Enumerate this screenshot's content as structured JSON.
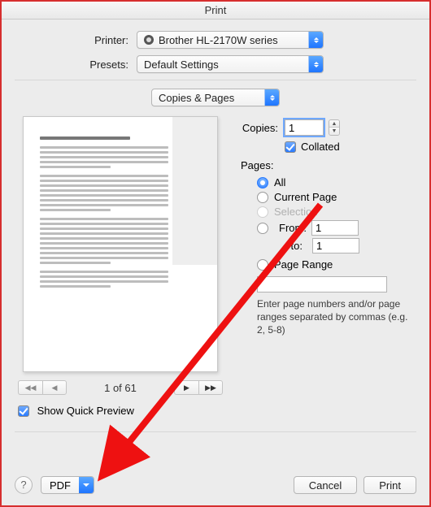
{
  "title": "Print",
  "labels": {
    "printer": "Printer:",
    "presets": "Presets:",
    "copies": "Copies:",
    "collated": "Collated",
    "pages": "Pages:",
    "all": "All",
    "current_page": "Current Page",
    "selection": "Selection",
    "from": "From:",
    "to": "to:",
    "page_range": "Page Range",
    "hint": "Enter page numbers and/or page ranges separated by commas (e.g. 2, 5-8)",
    "show_quick_preview": "Show Quick Preview",
    "of": "of"
  },
  "printer": {
    "selected": "Brother HL-2170W series"
  },
  "presets": {
    "selected": "Default Settings"
  },
  "pane": {
    "selected": "Copies & Pages"
  },
  "copies": {
    "value": "1"
  },
  "pages": {
    "from_value": "1",
    "to_value": "1",
    "range_value": ""
  },
  "preview": {
    "current": "1",
    "total": "61"
  },
  "buttons": {
    "pdf": "PDF",
    "cancel": "Cancel",
    "print": "Print",
    "help": "?"
  }
}
